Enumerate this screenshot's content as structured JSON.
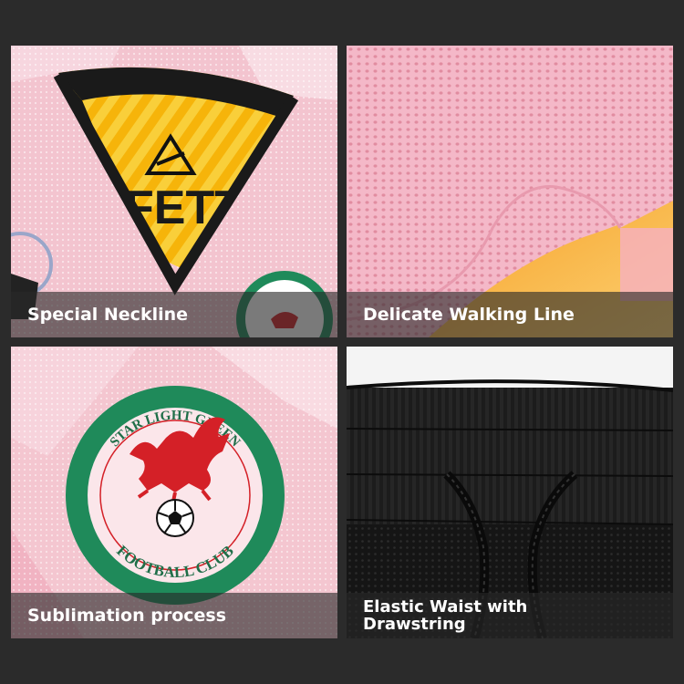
{
  "panels": [
    {
      "caption": "Special Neckline"
    },
    {
      "caption": "Delicate Walking Line"
    },
    {
      "caption": "Sublimation process"
    },
    {
      "caption_line1": "Elastic Waist with",
      "caption_line2": "Drawstring"
    }
  ],
  "crest": {
    "top_text": "STAR LIGHT GREEN",
    "bottom_text": "FOOTBALL CLUB"
  },
  "collar_print": "FETT",
  "colors": {
    "pink": "#f3c4cf",
    "yellow": "#f5b400",
    "green": "#1f8a5a",
    "dragon_red": "#d42027",
    "black": "#1e1e1e"
  }
}
